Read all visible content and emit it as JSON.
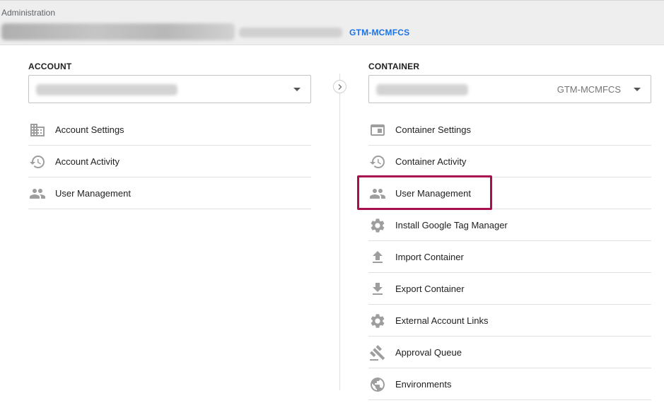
{
  "header": {
    "breadcrumb": "Administration",
    "container_id": "GTM-MCMFCS"
  },
  "account": {
    "title": "ACCOUNT",
    "items": [
      {
        "label": "Account Settings",
        "icon": "building-icon"
      },
      {
        "label": "Account Activity",
        "icon": "history-icon"
      },
      {
        "label": "User Management",
        "icon": "people-icon"
      }
    ]
  },
  "container": {
    "title": "CONTAINER",
    "selected_id": "GTM-MCMFCS",
    "items": [
      {
        "label": "Container Settings",
        "icon": "browser-window-icon"
      },
      {
        "label": "Container Activity",
        "icon": "history-icon"
      },
      {
        "label": "User Management",
        "icon": "people-icon",
        "highlighted": true
      },
      {
        "label": "Install Google Tag Manager",
        "icon": "gear-icon"
      },
      {
        "label": "Import Container",
        "icon": "upload-icon"
      },
      {
        "label": "Export Container",
        "icon": "download-icon"
      },
      {
        "label": "External Account Links",
        "icon": "gear-icon"
      },
      {
        "label": "Approval Queue",
        "icon": "gavel-icon"
      },
      {
        "label": "Environments",
        "icon": "globe-icon"
      }
    ]
  },
  "colors": {
    "icon": "#9e9e9e",
    "highlight_border": "#a80f4e",
    "link_blue": "#1a73e8"
  }
}
